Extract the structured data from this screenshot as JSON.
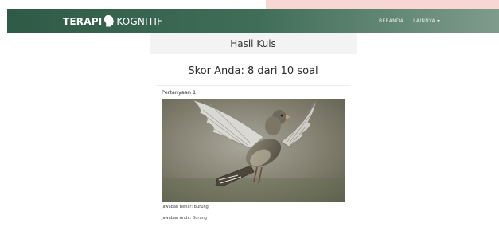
{
  "navbar": {
    "brand_bold": "TERAPI",
    "brand_light": "KOGNITIF",
    "brand_icon": "head-silhouette-icon",
    "links": [
      "BERANDA",
      "LAINNYA"
    ]
  },
  "quiz": {
    "header_title": "Hasil Kuis",
    "score_text": "Skor Anda: 8 dari 10 soal",
    "question_label": "Pertanyaan 1:",
    "image_subject": "bird",
    "correct_answer": "Jawaban Benar: Burung",
    "your_answer": "Jawaban Anda: Burung"
  },
  "colors": {
    "navbar_start": "#2f5a47",
    "navbar_end": "#7f9b8c",
    "accent_strip": "#f8d6d4"
  }
}
